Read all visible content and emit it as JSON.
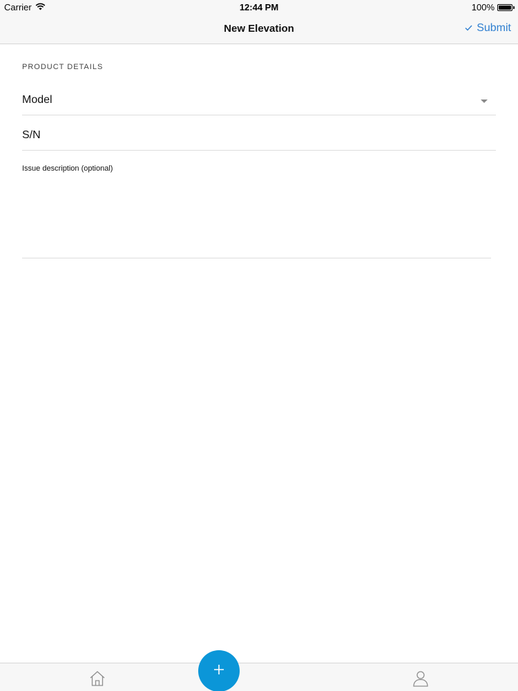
{
  "status_bar": {
    "carrier": "Carrier",
    "time": "12:44 PM",
    "battery": "100%",
    "battery_level": 1.0
  },
  "nav": {
    "title": "New Elevation",
    "submit_label": "Submit",
    "submit_icon": "checkmark-icon",
    "accent_color": "#2f7fd0"
  },
  "form": {
    "section_header": "PRODUCT DETAILS",
    "model_label": "Model",
    "sn_label": "S/N",
    "issue_label": "Issue description (optional)"
  },
  "tab_bar": {
    "home_icon": "home-icon",
    "add_icon": "plus-icon",
    "profile_icon": "person-icon",
    "fab_color": "#0b96d8"
  }
}
